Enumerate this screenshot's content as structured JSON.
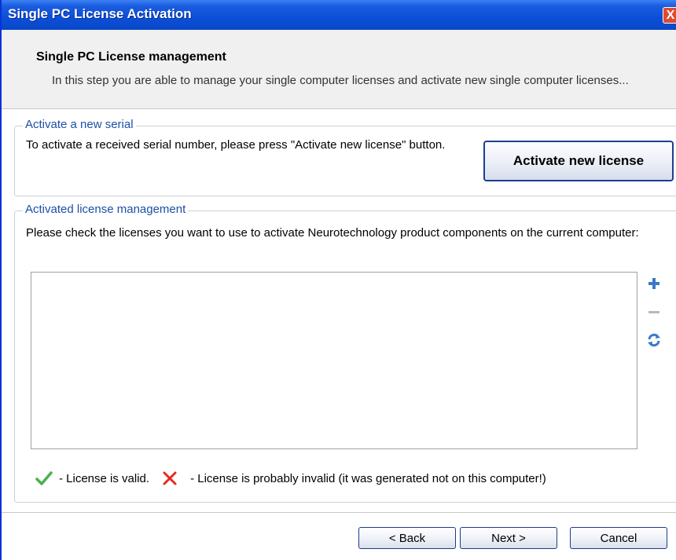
{
  "window": {
    "title": "Single PC License Activation",
    "close_label": "X"
  },
  "header": {
    "title": "Single PC License management",
    "description": "In this step you are able to manage your single computer licenses and activate new single computer licenses..."
  },
  "activate_group": {
    "legend": "Activate a new serial",
    "instruction": "To activate a received serial number, please press \"Activate new license\" button.",
    "button_label": "Activate new license"
  },
  "management_group": {
    "legend": "Activated license management",
    "instruction": "Please check the licenses you want to use to activate Neurotechnology product components on the current computer:",
    "licenses": [],
    "tools": [
      {
        "icon": "plus-icon"
      },
      {
        "icon": "minus-icon"
      },
      {
        "icon": "refresh-icon"
      }
    ],
    "legend_items": [
      {
        "icon": "checkmark-icon",
        "text": "- License is valid.",
        "color": "#4caf50"
      },
      {
        "icon": "cross-icon",
        "text": "- License is probably invalid (it was generated not on this computer!)",
        "color": "#e8281e"
      }
    ]
  },
  "footer": {
    "back_label": "< Back",
    "next_label": "Next >",
    "cancel_label": "Cancel"
  }
}
